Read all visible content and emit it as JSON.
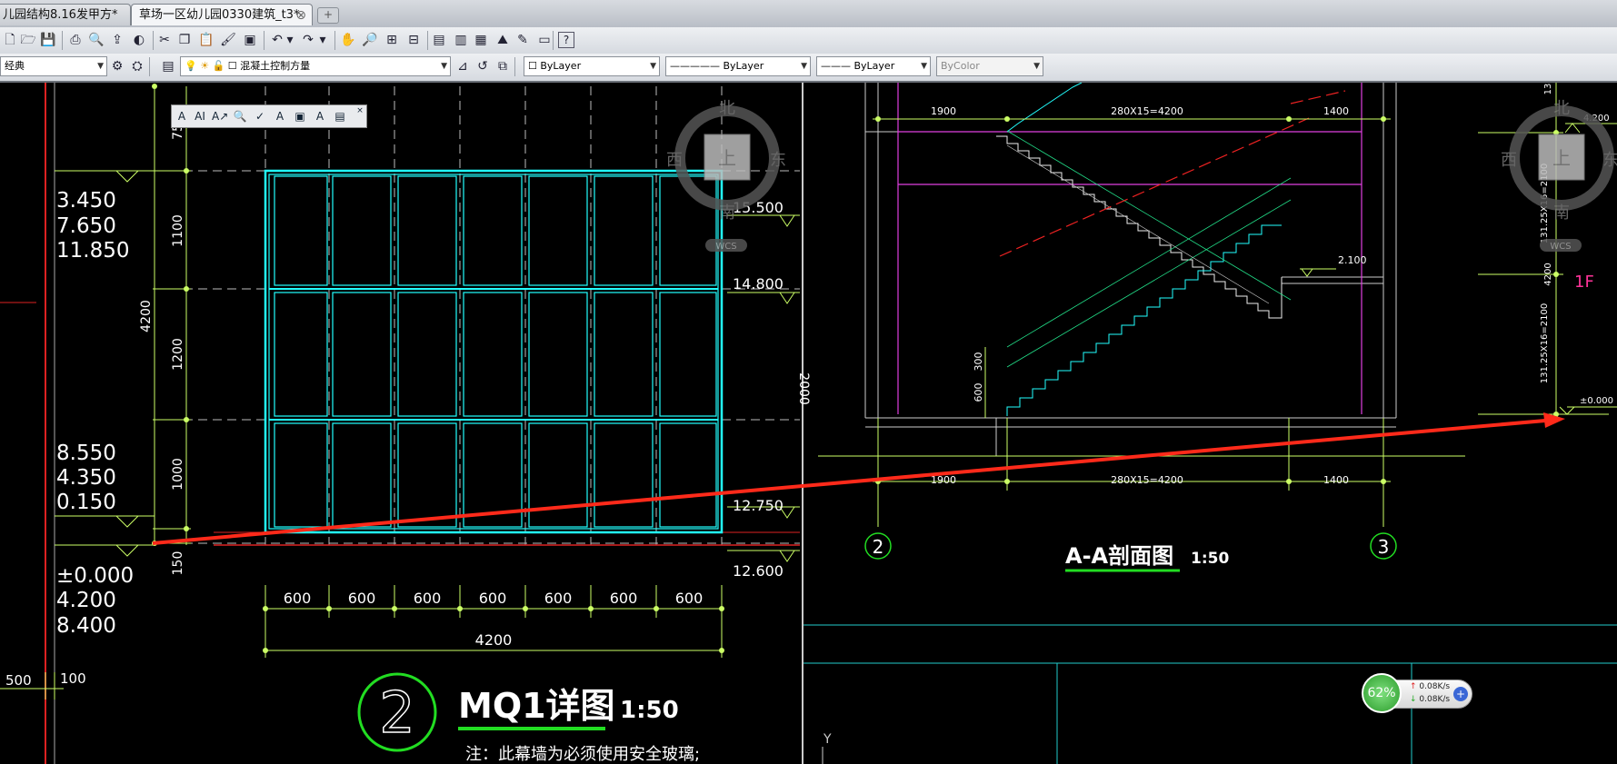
{
  "tabs": [
    {
      "label": "儿园结构8.16发甲方*",
      "active": false
    },
    {
      "label": "草场一区幼儿园0330建筑_t3*",
      "active": true
    }
  ],
  "toolbar": {
    "workspace": "经典",
    "layer": "混凝土控制方量",
    "color": "ByLayer",
    "linetype": "ByLayer",
    "lineweight": "ByLayer",
    "plotstyle": "ByColor"
  },
  "compass": {
    "north": "北",
    "south": "南",
    "east": "东",
    "west": "西",
    "top": "上",
    "wcs": "WCS"
  },
  "left_drawing": {
    "elevations_a": [
      "3.450",
      "7.650",
      "11.850"
    ],
    "elevations_b": [
      "8.550",
      "4.350",
      "0.150"
    ],
    "elevations_c": [
      "±0.000",
      "4.200",
      "8.400"
    ],
    "dim_left": [
      "75",
      "1100",
      "1200",
      "1000",
      "150"
    ],
    "dim_total_vertical": "4200",
    "dim_bottom": [
      "600",
      "600",
      "600",
      "600",
      "600",
      "600",
      "600"
    ],
    "dim_total": "4200",
    "right_levels": [
      "15.500",
      "14.800",
      "12.750",
      "12.600"
    ],
    "dim_bl": [
      "500",
      "100"
    ],
    "title": "MQ1详图",
    "scale": "1:50",
    "number": "2",
    "note": "注：此幕墙为必须使用安全玻璃;"
  },
  "right_drawing": {
    "dim_top": [
      "1900",
      "280X15=4200",
      "1400"
    ],
    "dim_bottom": [
      "1900",
      "280X15=4200",
      "1400"
    ],
    "level_mid": "2.100",
    "dim_v": [
      "300",
      "600"
    ],
    "side_label": "2000",
    "axis_2": "2",
    "axis_3": "3",
    "title": "A-A剖面图",
    "scale": "1:50",
    "far_dims": [
      "131.25X16=2100",
      "4200",
      "131.25X16=2100",
      "13"
    ],
    "far_levels": [
      "4.200",
      "±0.000"
    ],
    "floor_label": "1F",
    "ucs_y": "Y"
  },
  "net_monitor": {
    "percent": "62%",
    "up": "0.08K/s",
    "down": "0.08K/s"
  }
}
